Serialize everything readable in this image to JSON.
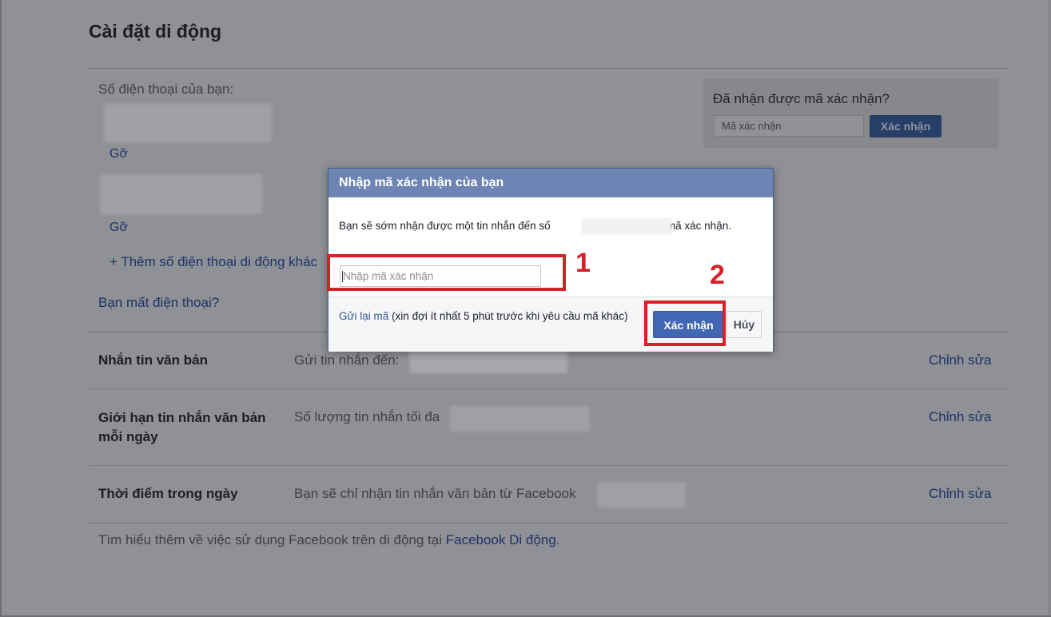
{
  "page": {
    "title": "Cài đặt di động",
    "phone_section": {
      "label": "Số điện thoại của bạn:",
      "remove_1": "Gỡ",
      "remove_2": "Gỡ",
      "add_phone": "+ Thêm số điện thoại di động khác",
      "lost_phone": "Bạn mất điện thoại?"
    },
    "confirm_box": {
      "title": "Đã nhận được mã xác nhận?",
      "input_placeholder": "Mã xác nhận",
      "button": "Xác nhận"
    },
    "rows": [
      {
        "label": "Nhắn tin văn bản",
        "desc": "Gửi tin nhắn đến:",
        "edit": "Chỉnh sửa"
      },
      {
        "label": "Giới hạn tin nhắn văn bản mỗi ngày",
        "desc": "Số lượng tin nhắn tối đa",
        "edit": "Chỉnh sửa"
      },
      {
        "label": "Thời điểm trong ngày",
        "desc": "Bạn sẽ chỉ nhận tin nhắn văn bản từ Facebook",
        "edit": "Chỉnh sửa"
      }
    ],
    "footer": {
      "text": "Tìm hiểu thêm về việc sử dụng Facebook trên di động tại ",
      "link": "Facebook Di động",
      "end": "."
    }
  },
  "dialog": {
    "title": "Nhập mã xác nhận của bạn",
    "body_before": "Bạn sẽ sớm nhận được một tin nhắn đến số",
    "body_after": "kèm mã xác nhận.",
    "input_placeholder": "Nhập mã xác nhận",
    "resend_link": "Gửi lại mã",
    "resend_note": " (xin đợi ít nhất 5 phút trước khi yêu cầu mã khác)",
    "confirm_button": "Xác nhận",
    "cancel_button": "Hủy"
  },
  "annotations": {
    "step_1": "1",
    "step_2": "2"
  },
  "colors": {
    "accent": "#4267b2",
    "header": "#6d84b4",
    "marker": "#d61f26"
  }
}
